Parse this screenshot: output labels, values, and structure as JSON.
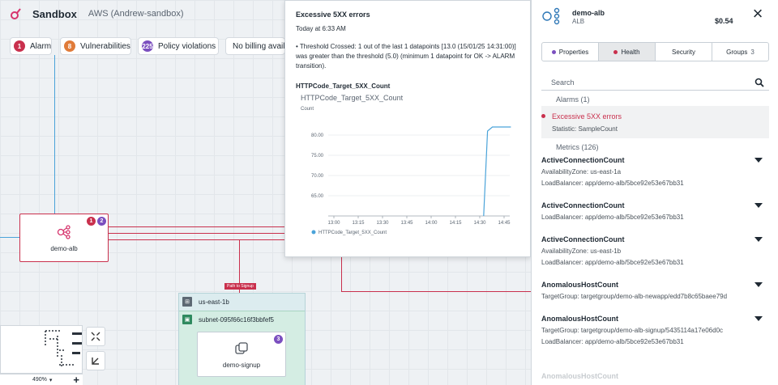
{
  "app": {
    "title": "Sandbox",
    "account": "AWS (Andrew-sandbox)"
  },
  "chips": [
    {
      "count": "1",
      "label": "Alarm",
      "color": "#c9304d"
    },
    {
      "count": "8",
      "label": "Vulnerabilities",
      "color": "#e07b39"
    },
    {
      "count": "225",
      "label": "Policy violations",
      "color": "#7b4fbf"
    },
    {
      "count": "",
      "label": "No billing availab",
      "color": ""
    }
  ],
  "canvas": {
    "demo_alb": {
      "label": "demo-alb",
      "badge_alarm": "1",
      "badge_policy": "2"
    },
    "zone": {
      "label": "us-east-1b"
    },
    "subnet": {
      "label": "subnet-095f66c16f3bbfef5"
    },
    "demo_signup": {
      "label": "demo-signup",
      "badge": "3"
    },
    "path_label": "Path to Signup",
    "zoom_level": "490%"
  },
  "popover": {
    "title": "Excessive 5XX errors",
    "time": "Today at 6:33 AM",
    "description": "• Threshold Crossed: 1 out of the last 1 datapoints [13.0 (15/01/25 14:31:00)] was greater than the threshold (5.0) (minimum 1 datapoint for OK -> ALARM transition).",
    "metric_title": "HTTPCode_Target_5XX_Count"
  },
  "chart_data": {
    "type": "line",
    "title": "HTTPCode_Target_5XX_Count",
    "ylabel": "Count",
    "xlabel": "",
    "categories": [
      "13:00",
      "13:15",
      "13:30",
      "13:45",
      "14:00",
      "14:15",
      "14:30",
      "14:45"
    ],
    "ylim": [
      60,
      85
    ],
    "yticks": [
      "80.00",
      "75.00",
      "70.00",
      "65.00"
    ],
    "yticks_values": [
      80,
      75,
      70,
      65
    ],
    "series": [
      {
        "name": "HTTPCode_Target_5XX_Count",
        "color": "#4aa3d9",
        "x": [
          14.54,
          14.58,
          14.63,
          14.66,
          14.82
        ],
        "y": [
          60,
          81,
          82,
          82,
          82
        ]
      }
    ],
    "legend": "bottom-left",
    "grid": true
  },
  "panel": {
    "name": "demo-alb",
    "type": "ALB",
    "cost": "$0.54",
    "tabs": [
      {
        "label": "Properties",
        "dot": "#7b4fbf"
      },
      {
        "label": "Health",
        "dot": "#c9304d"
      },
      {
        "label": "Security",
        "dot": ""
      },
      {
        "label": "Groups",
        "count": "3"
      }
    ],
    "search_placeholder": "Search",
    "alarms_header": "Alarms (1)",
    "alarm": {
      "name": "Excessive 5XX errors",
      "statistic": "Statistic: SampleCount"
    },
    "metrics_header": "Metrics (126)",
    "metrics": [
      {
        "name": "ActiveConnectionCount",
        "dims": [
          "AvailabilityZone: us-east-1a",
          "LoadBalancer: app/demo-alb/5bce92e53e67bb31"
        ]
      },
      {
        "name": "ActiveConnectionCount",
        "dims": [
          "LoadBalancer: app/demo-alb/5bce92e53e67bb31"
        ]
      },
      {
        "name": "ActiveConnectionCount",
        "dims": [
          "AvailabilityZone: us-east-1b",
          "LoadBalancer: app/demo-alb/5bce92e53e67bb31"
        ]
      },
      {
        "name": "AnomalousHostCount",
        "dims": [
          "TargetGroup: targetgroup/demo-alb-newapp/edd7b8c65baee79d"
        ]
      },
      {
        "name": "AnomalousHostCount",
        "dims": [
          "TargetGroup: targetgroup/demo-alb-signup/5435114a17e06d0c",
          "LoadBalancer: app/demo-alb/5bce92e53e67bb31"
        ]
      }
    ],
    "trailing_item": "AnomalousHostCount"
  }
}
